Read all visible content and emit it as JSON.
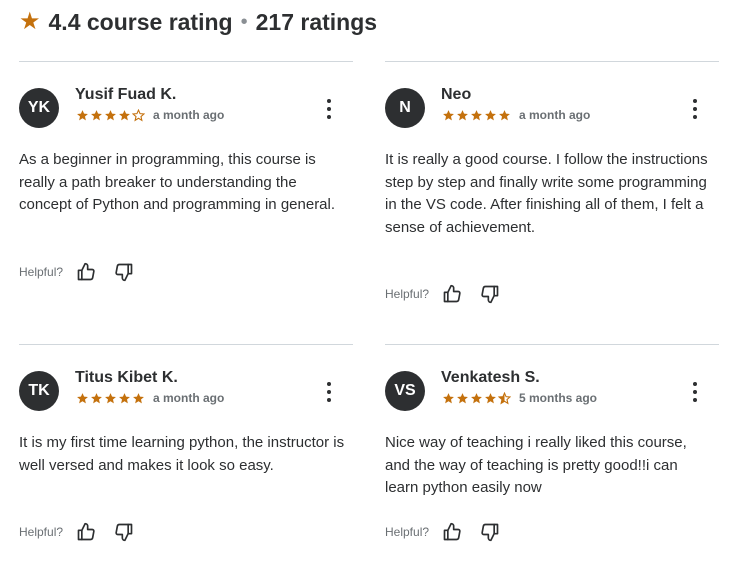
{
  "summary": {
    "rating_text": "4.4 course rating",
    "ratings_count": "217 ratings",
    "separator": "•",
    "star_color": "#c4710d"
  },
  "reviews": [
    {
      "initials": "YK",
      "name": "Yusif Fuad K.",
      "stars": 4,
      "time": "a month ago",
      "text": "As a beginner in programming, this course is really a path breaker to understanding the concept of Python and programming in general.",
      "helpful_label": "Helpful?"
    },
    {
      "initials": "N",
      "name": "Neo",
      "stars": 5,
      "time": "a month ago",
      "text": "It is really a good course. I follow the instructions step by step and finally write some programming in the VS code. After finishing all of them, I felt a sense of achievement.",
      "helpful_label": "Helpful?"
    },
    {
      "initials": "TK",
      "name": "Titus Kibet K.",
      "stars": 5,
      "time": "a month ago",
      "text": "It is my first time learning python, the instructor is well versed and makes it look so easy.",
      "helpful_label": "Helpful?"
    },
    {
      "initials": "VS",
      "name": "Venkatesh S.",
      "stars": 4.5,
      "time": "5 months ago",
      "text": "Nice way of teaching i really liked this course, and the way of teaching is pretty good!!i can learn python easily now",
      "helpful_label": "Helpful?"
    }
  ],
  "icons": {
    "rating_star": "star-icon",
    "menu": "more-vertical-icon",
    "like": "thumbs-up-icon",
    "dislike": "thumbs-down-icon"
  }
}
